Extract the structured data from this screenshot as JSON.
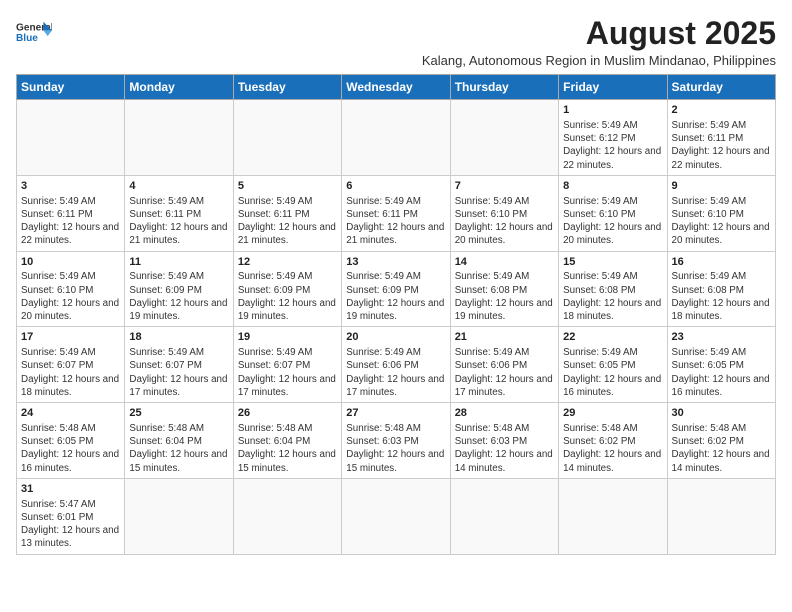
{
  "logo": {
    "line1": "General",
    "line2": "Blue"
  },
  "title": "August 2025",
  "subtitle": "Kalang, Autonomous Region in Muslim Mindanao, Philippines",
  "weekdays": [
    "Sunday",
    "Monday",
    "Tuesday",
    "Wednesday",
    "Thursday",
    "Friday",
    "Saturday"
  ],
  "weeks": [
    [
      {
        "day": "",
        "info": ""
      },
      {
        "day": "",
        "info": ""
      },
      {
        "day": "",
        "info": ""
      },
      {
        "day": "",
        "info": ""
      },
      {
        "day": "",
        "info": ""
      },
      {
        "day": "1",
        "info": "Sunrise: 5:49 AM\nSunset: 6:12 PM\nDaylight: 12 hours\nand 22 minutes."
      },
      {
        "day": "2",
        "info": "Sunrise: 5:49 AM\nSunset: 6:11 PM\nDaylight: 12 hours\nand 22 minutes."
      }
    ],
    [
      {
        "day": "3",
        "info": "Sunrise: 5:49 AM\nSunset: 6:11 PM\nDaylight: 12 hours\nand 22 minutes."
      },
      {
        "day": "4",
        "info": "Sunrise: 5:49 AM\nSunset: 6:11 PM\nDaylight: 12 hours\nand 21 minutes."
      },
      {
        "day": "5",
        "info": "Sunrise: 5:49 AM\nSunset: 6:11 PM\nDaylight: 12 hours\nand 21 minutes."
      },
      {
        "day": "6",
        "info": "Sunrise: 5:49 AM\nSunset: 6:11 PM\nDaylight: 12 hours\nand 21 minutes."
      },
      {
        "day": "7",
        "info": "Sunrise: 5:49 AM\nSunset: 6:10 PM\nDaylight: 12 hours\nand 20 minutes."
      },
      {
        "day": "8",
        "info": "Sunrise: 5:49 AM\nSunset: 6:10 PM\nDaylight: 12 hours\nand 20 minutes."
      },
      {
        "day": "9",
        "info": "Sunrise: 5:49 AM\nSunset: 6:10 PM\nDaylight: 12 hours\nand 20 minutes."
      }
    ],
    [
      {
        "day": "10",
        "info": "Sunrise: 5:49 AM\nSunset: 6:10 PM\nDaylight: 12 hours\nand 20 minutes."
      },
      {
        "day": "11",
        "info": "Sunrise: 5:49 AM\nSunset: 6:09 PM\nDaylight: 12 hours\nand 19 minutes."
      },
      {
        "day": "12",
        "info": "Sunrise: 5:49 AM\nSunset: 6:09 PM\nDaylight: 12 hours\nand 19 minutes."
      },
      {
        "day": "13",
        "info": "Sunrise: 5:49 AM\nSunset: 6:09 PM\nDaylight: 12 hours\nand 19 minutes."
      },
      {
        "day": "14",
        "info": "Sunrise: 5:49 AM\nSunset: 6:08 PM\nDaylight: 12 hours\nand 19 minutes."
      },
      {
        "day": "15",
        "info": "Sunrise: 5:49 AM\nSunset: 6:08 PM\nDaylight: 12 hours\nand 18 minutes."
      },
      {
        "day": "16",
        "info": "Sunrise: 5:49 AM\nSunset: 6:08 PM\nDaylight: 12 hours\nand 18 minutes."
      }
    ],
    [
      {
        "day": "17",
        "info": "Sunrise: 5:49 AM\nSunset: 6:07 PM\nDaylight: 12 hours\nand 18 minutes."
      },
      {
        "day": "18",
        "info": "Sunrise: 5:49 AM\nSunset: 6:07 PM\nDaylight: 12 hours\nand 17 minutes."
      },
      {
        "day": "19",
        "info": "Sunrise: 5:49 AM\nSunset: 6:07 PM\nDaylight: 12 hours\nand 17 minutes."
      },
      {
        "day": "20",
        "info": "Sunrise: 5:49 AM\nSunset: 6:06 PM\nDaylight: 12 hours\nand 17 minutes."
      },
      {
        "day": "21",
        "info": "Sunrise: 5:49 AM\nSunset: 6:06 PM\nDaylight: 12 hours\nand 17 minutes."
      },
      {
        "day": "22",
        "info": "Sunrise: 5:49 AM\nSunset: 6:05 PM\nDaylight: 12 hours\nand 16 minutes."
      },
      {
        "day": "23",
        "info": "Sunrise: 5:49 AM\nSunset: 6:05 PM\nDaylight: 12 hours\nand 16 minutes."
      }
    ],
    [
      {
        "day": "24",
        "info": "Sunrise: 5:48 AM\nSunset: 6:05 PM\nDaylight: 12 hours\nand 16 minutes."
      },
      {
        "day": "25",
        "info": "Sunrise: 5:48 AM\nSunset: 6:04 PM\nDaylight: 12 hours\nand 15 minutes."
      },
      {
        "day": "26",
        "info": "Sunrise: 5:48 AM\nSunset: 6:04 PM\nDaylight: 12 hours\nand 15 minutes."
      },
      {
        "day": "27",
        "info": "Sunrise: 5:48 AM\nSunset: 6:03 PM\nDaylight: 12 hours\nand 15 minutes."
      },
      {
        "day": "28",
        "info": "Sunrise: 5:48 AM\nSunset: 6:03 PM\nDaylight: 12 hours\nand 14 minutes."
      },
      {
        "day": "29",
        "info": "Sunrise: 5:48 AM\nSunset: 6:02 PM\nDaylight: 12 hours\nand 14 minutes."
      },
      {
        "day": "30",
        "info": "Sunrise: 5:48 AM\nSunset: 6:02 PM\nDaylight: 12 hours\nand 14 minutes."
      }
    ],
    [
      {
        "day": "31",
        "info": "Sunrise: 5:47 AM\nSunset: 6:01 PM\nDaylight: 12 hours\nand 13 minutes."
      },
      {
        "day": "",
        "info": ""
      },
      {
        "day": "",
        "info": ""
      },
      {
        "day": "",
        "info": ""
      },
      {
        "day": "",
        "info": ""
      },
      {
        "day": "",
        "info": ""
      },
      {
        "day": "",
        "info": ""
      }
    ]
  ]
}
